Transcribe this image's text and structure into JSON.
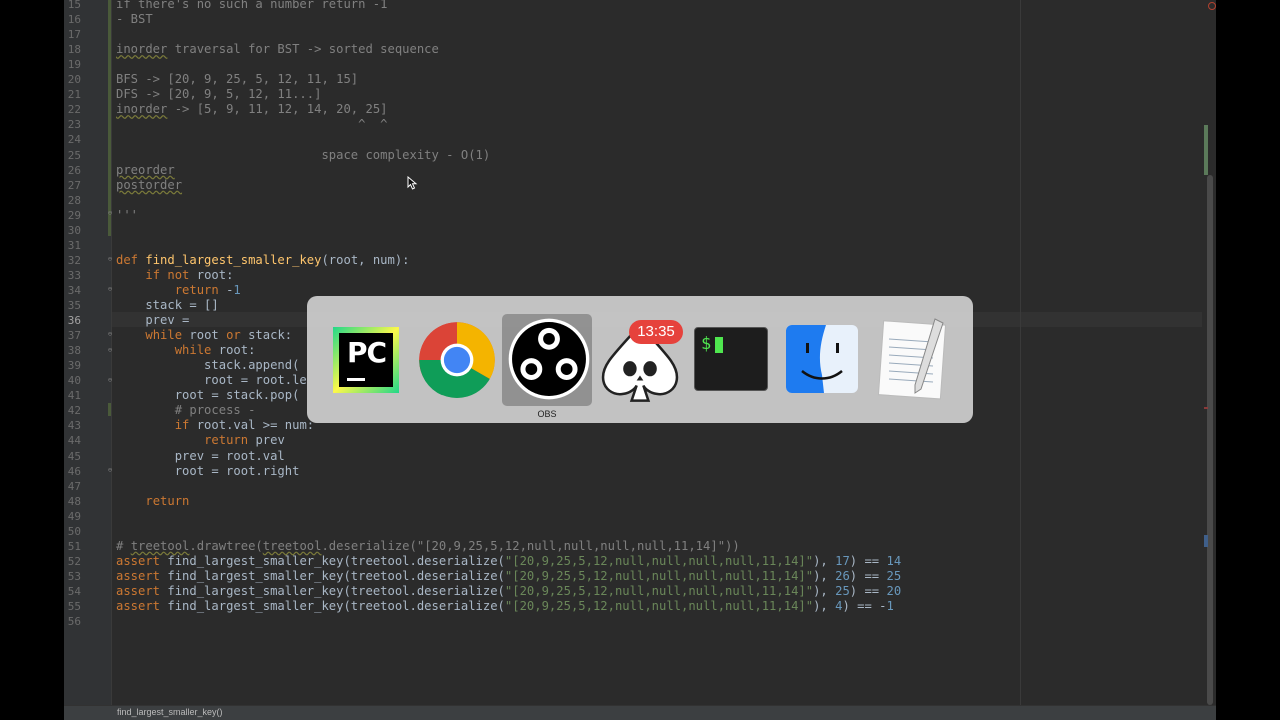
{
  "editor": {
    "lines": [
      {
        "num": "15",
        "html": "<span class='c'>if there's no such a number return -1</span>"
      },
      {
        "num": "16",
        "html": "<span class='c'>- BST</span>"
      },
      {
        "num": "17",
        "html": ""
      },
      {
        "num": "18",
        "html": "<span class='c'><span class='u'>inorder</span> traversal for BST -&gt; sorted sequence</span>"
      },
      {
        "num": "19",
        "html": ""
      },
      {
        "num": "20",
        "html": "<span class='c'>BFS -&gt; [20, 9, 25, 5, 12, 11, 15]</span>"
      },
      {
        "num": "21",
        "html": "<span class='c'>DFS -&gt; [20, 9, 5, 12, 11...]</span>"
      },
      {
        "num": "22",
        "html": "<span class='c'><span class='u'>inorder</span> -&gt; [5, 9, 11, 12, 14, 20, 25]</span>"
      },
      {
        "num": "23",
        "html": "<span class='c'>                                 ^  ^</span>"
      },
      {
        "num": "24",
        "html": ""
      },
      {
        "num": "25",
        "html": "<span class='c'>                            space complexity - O(1)</span>"
      },
      {
        "num": "26",
        "html": "<span class='c'><span class='u'>preorder</span></span>"
      },
      {
        "num": "27",
        "html": "<span class='c'><span class='u'>postorder</span></span>"
      },
      {
        "num": "28",
        "html": ""
      },
      {
        "num": "29",
        "html": "<span class='c'>'''</span>"
      },
      {
        "num": "30",
        "html": ""
      },
      {
        "num": "31",
        "html": ""
      },
      {
        "num": "32",
        "html": "<span class='k'>def </span><span class='f'>find_largest_smaller_key</span>(root, num):"
      },
      {
        "num": "33",
        "html": "    <span class='k'>if not </span>root:"
      },
      {
        "num": "34",
        "html": "        <span class='k'>return </span>-<span class='n'>1</span>"
      },
      {
        "num": "35",
        "html": "    stack = []"
      },
      {
        "num": "36",
        "html": "    prev = "
      },
      {
        "num": "37",
        "html": "    <span class='k'>while </span>root <span class='k'>or </span>stack:"
      },
      {
        "num": "38",
        "html": "        <span class='k'>while </span>root:"
      },
      {
        "num": "39",
        "html": "            stack.append("
      },
      {
        "num": "40",
        "html": "            root = root.le"
      },
      {
        "num": "41",
        "html": "        root = stack.pop("
      },
      {
        "num": "42",
        "html": "        <span class='c'># process -</span>"
      },
      {
        "num": "43",
        "html": "        <span class='k'>if </span>root.val &gt;= num:"
      },
      {
        "num": "44",
        "html": "            <span class='k'>return </span>prev"
      },
      {
        "num": "45",
        "html": "        prev = root.val"
      },
      {
        "num": "46",
        "html": "        root = root.right"
      },
      {
        "num": "47",
        "html": ""
      },
      {
        "num": "48",
        "html": "    <span class='k'>return</span>"
      },
      {
        "num": "49",
        "html": ""
      },
      {
        "num": "50",
        "html": ""
      },
      {
        "num": "51",
        "html": "<span class='c'># <span class='u'>treetool</span>.drawtree(<span class='u'>treetool</span>.deserialize(\"[20,9,25,5,12,null,null,null,null,11,14]\"))</span>"
      },
      {
        "num": "52",
        "html": "<span class='k'>assert </span>find_largest_smaller_key(treetool.deserialize(<span class='s'>\"[20,9,25,5,12,null,null,null,null,11,14]\"</span>), <span class='n'>17</span>) == <span class='n'>14</span>"
      },
      {
        "num": "53",
        "html": "<span class='k'>assert </span>find_largest_smaller_key(treetool.deserialize(<span class='s'>\"[20,9,25,5,12,null,null,null,null,11,14]\"</span>), <span class='n'>26</span>) == <span class='n'>25</span>"
      },
      {
        "num": "54",
        "html": "<span class='k'>assert </span>find_largest_smaller_key(treetool.deserialize(<span class='s'>\"[20,9,25,5,12,null,null,null,null,11,14]\"</span>), <span class='n'>25</span>) == <span class='n'>20</span>"
      },
      {
        "num": "55",
        "html": "<span class='k'>assert </span>find_largest_smaller_key(treetool.deserialize(<span class='s'>\"[20,9,25,5,12,null,null,null,null,11,14]\"</span>), <span class='n'>4</span>) == -<span class='n'>1</span>"
      },
      {
        "num": "56",
        "html": ""
      }
    ],
    "current_line": "36"
  },
  "statusbar": {
    "breadcrumb": "find_largest_smaller_key()"
  },
  "app_switcher": {
    "apps": [
      {
        "id": "pycharm",
        "icon": "pycharm-icon",
        "icon_text": "PC"
      },
      {
        "id": "chrome",
        "icon": "chrome-icon"
      },
      {
        "id": "obs",
        "icon": "obs-icon",
        "label": "OBS",
        "selected": true
      },
      {
        "id": "solitaire",
        "icon": "skull-spade-icon",
        "badge": "13:35"
      },
      {
        "id": "terminal",
        "icon": "terminal-icon",
        "prompt": "$"
      },
      {
        "id": "finder",
        "icon": "finder-icon"
      },
      {
        "id": "textedit",
        "icon": "textedit-icon"
      }
    ]
  },
  "colors": {
    "background": "#2b2b2b",
    "keyword": "#cc7832",
    "function": "#ffc66d",
    "string": "#6a8759",
    "number": "#6897bb",
    "comment": "#808080"
  }
}
